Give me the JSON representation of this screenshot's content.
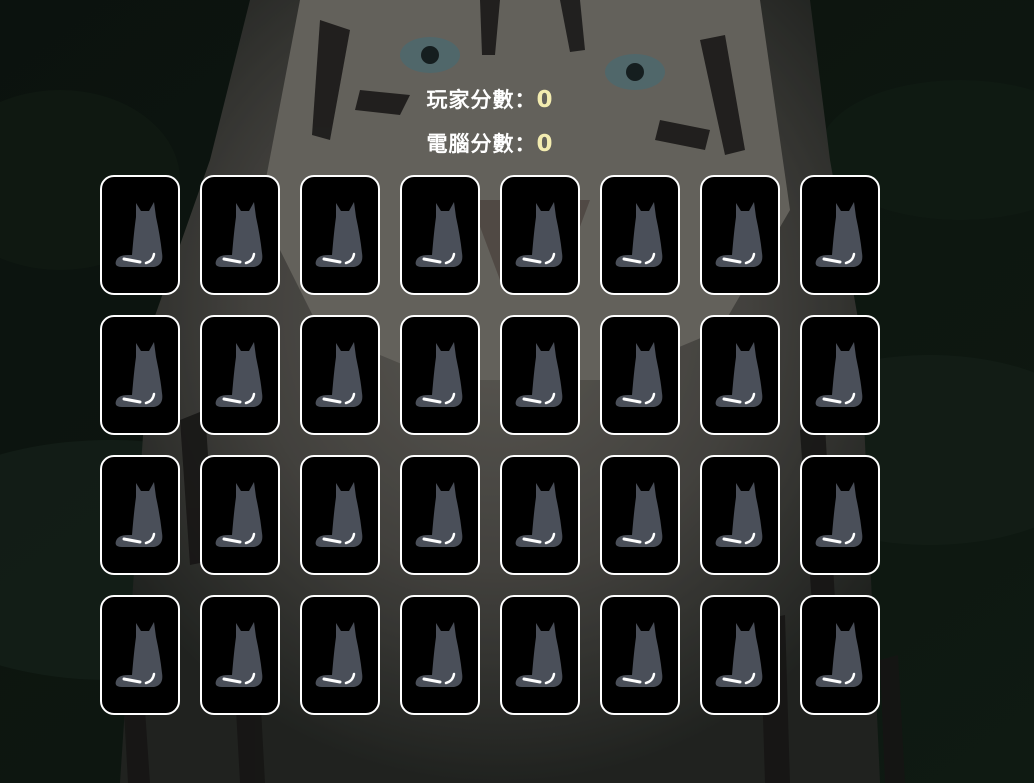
{
  "scoreboard": {
    "player_label": "玩家分數：",
    "player_score": "0",
    "computer_label": "電腦分數：",
    "computer_score": "0"
  },
  "board": {
    "rows": 4,
    "columns": 8,
    "card_state": "face-down",
    "card_back_icon": "cat-silhouette-icon"
  },
  "colors": {
    "background": "#0e1712",
    "card_face": "#000000",
    "card_border": "#ffffff",
    "cat_icon": "#4a4f59",
    "score_value": "#f3ecb0"
  }
}
